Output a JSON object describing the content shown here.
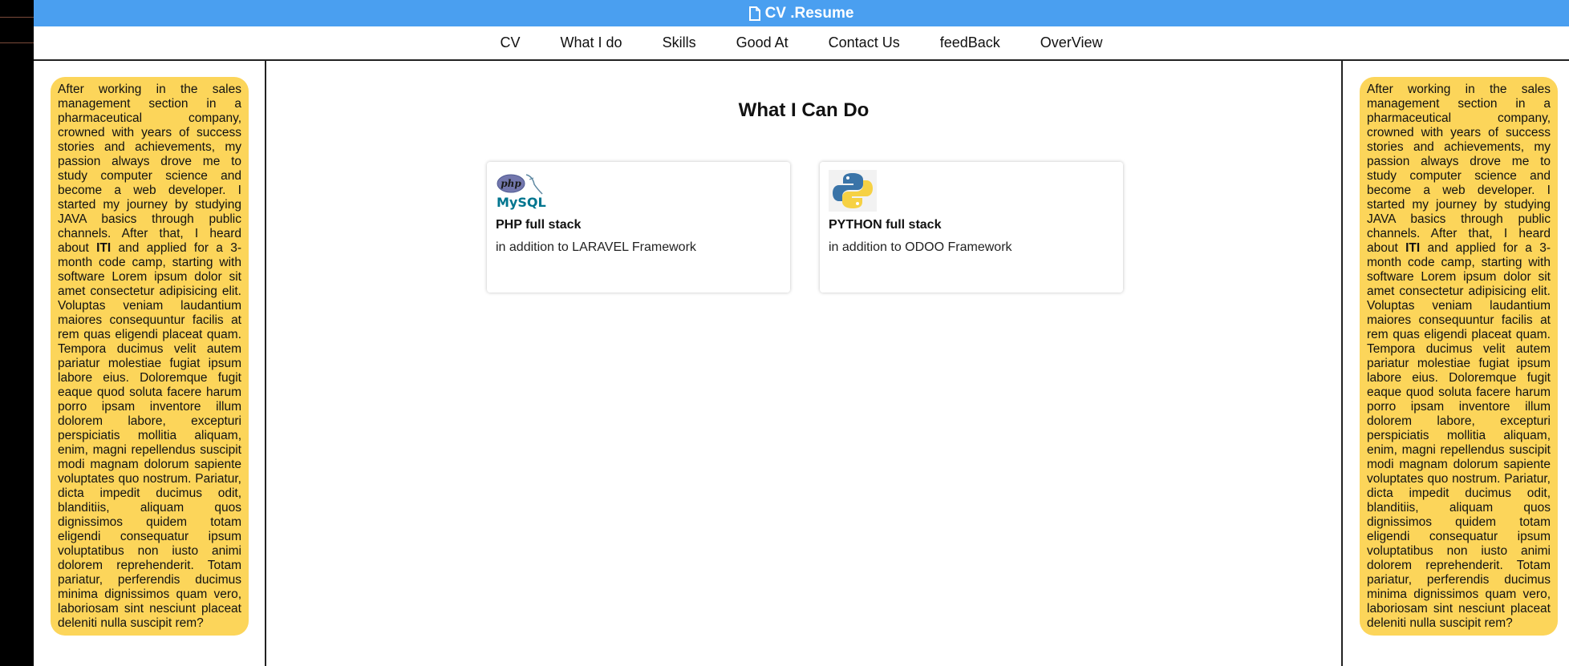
{
  "header": {
    "title": "CV .Resume",
    "icon": "document-icon"
  },
  "nav": {
    "items": [
      "CV",
      "What I do",
      "Skills",
      "Good At",
      "Contact Us",
      "feedBack",
      "OverView"
    ]
  },
  "about": {
    "text_before": "After working in the sales management section in a pharmaceutical company, crowned with years of success stories and achievements, my passion always drove me to study computer science and become a web developer. I started my journey by studying JAVA basics through public channels. After that, I heard about ",
    "highlight": "ITI",
    "text_after": " and applied for a 3-month code camp, starting with software Lorem ipsum dolor sit amet consectetur adipisicing elit. Voluptas veniam laudantium maiores consequuntur facilis at rem quas eligendi placeat quam. Tempora ducimus velit autem pariatur molestiae fugiat ipsum labore eius. Doloremque fugit eaque quod soluta facere harum porro ipsam inventore illum dolorem labore, excepturi perspiciatis mollitia aliquam, enim, magni repellendus suscipit modi magnam dolorum sapiente voluptates quo nostrum. Pariatur, dicta impedit ducimus odit, blanditiis, aliquam quos dignissimos quidem totam eligendi consequatur ipsum voluptatibus non iusto animi dolorem reprehenderit. Totam pariatur, perferendis ducimus minima dignissimos quam vero, laboriosam sint nesciunt placeat deleniti nulla suscipit rem?"
  },
  "main": {
    "heading": "What I Can Do",
    "cards": [
      {
        "logo": "php-mysql-logo",
        "logo_text_top": "php",
        "logo_text_bottom": "MySQL",
        "title": "PHP full stack",
        "description": "in addition to LARAVEL Framework"
      },
      {
        "logo": "python-logo",
        "title": "PYTHON full stack",
        "description": "in addition to ODOO Framework"
      }
    ]
  },
  "colors": {
    "topbar": "#4a9ff0",
    "about_card": "#fcd55a"
  }
}
